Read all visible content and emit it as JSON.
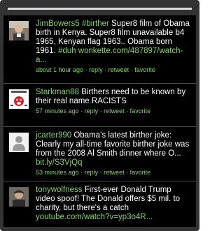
{
  "tweets": [
    {
      "user": "JimBowers5",
      "hashtag": "#birther",
      "text": "Super8 film of Obama birth in Kenya. Super8 film unavailable b4 1965, Kenyan flag 1963.. Obama born 1961.",
      "hashtag2": "#duh",
      "link": "wonkette.com/487897/watch-a...",
      "time": "about 1 hour ago",
      "reply": "reply",
      "retweet": "retweet",
      "favorite": "favorite",
      "avatar_icon": "user-photo-icon"
    },
    {
      "user": "Starkman88",
      "text": "Birthers need to be known by their real name RACISTS",
      "time": "57 minutes ago",
      "reply": "reply",
      "retweet": "retweet",
      "favorite": "favorite",
      "avatar_icon": "mr-noisy-icon"
    },
    {
      "user": "jcarter990",
      "text": "Obama’s latest birther joke: Clearly my all-time favorite birther joke was from the 2008 Al Smith dinner where O...",
      "link": "bit.ly/S3VjQq",
      "time": "53 minutes ago",
      "reply": "reply",
      "retweet": "retweet",
      "favorite": "favorite",
      "avatar_icon": "user-silhouette-icon"
    },
    {
      "user": "tonywolfness",
      "text": "First-ever Donald Trump video spoof! The Donald offers $5 mil. to charity, but there's a catch",
      "link": "youtube.com/watch?v=yp3o4R...",
      "avatar_icon": "user-photo-icon"
    }
  ],
  "colors": {
    "frame": "#333333",
    "background": "#000000",
    "link_green": "#7ed957",
    "text": "#ffffff"
  }
}
